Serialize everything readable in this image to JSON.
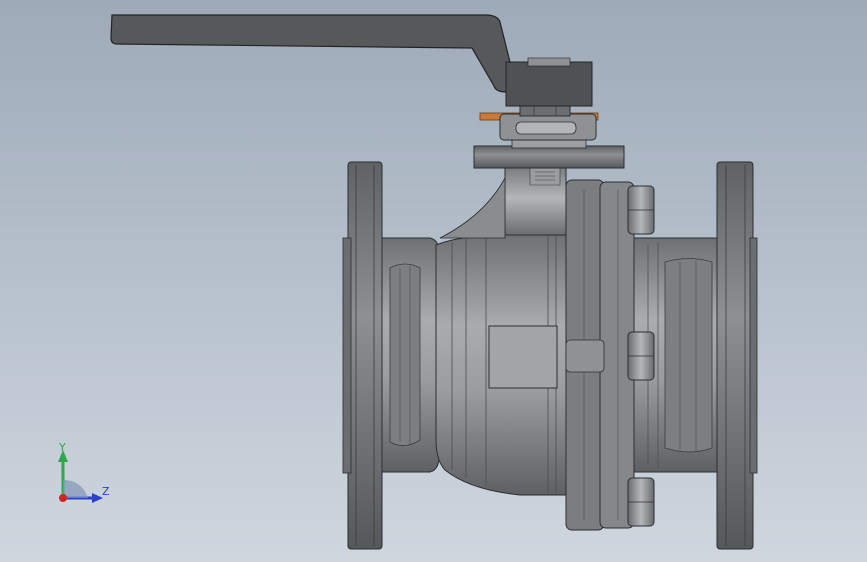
{
  "triad": {
    "y_label": "Y",
    "z_label": "Z",
    "colors": {
      "y": "#2fa84a",
      "z": "#2a3fd0",
      "x": "#d42020"
    }
  },
  "model": {
    "body_color": "#8c8f93",
    "flange_color": "#737679",
    "handle_color": "#56585a",
    "gasket_color": "#c87a3a"
  }
}
